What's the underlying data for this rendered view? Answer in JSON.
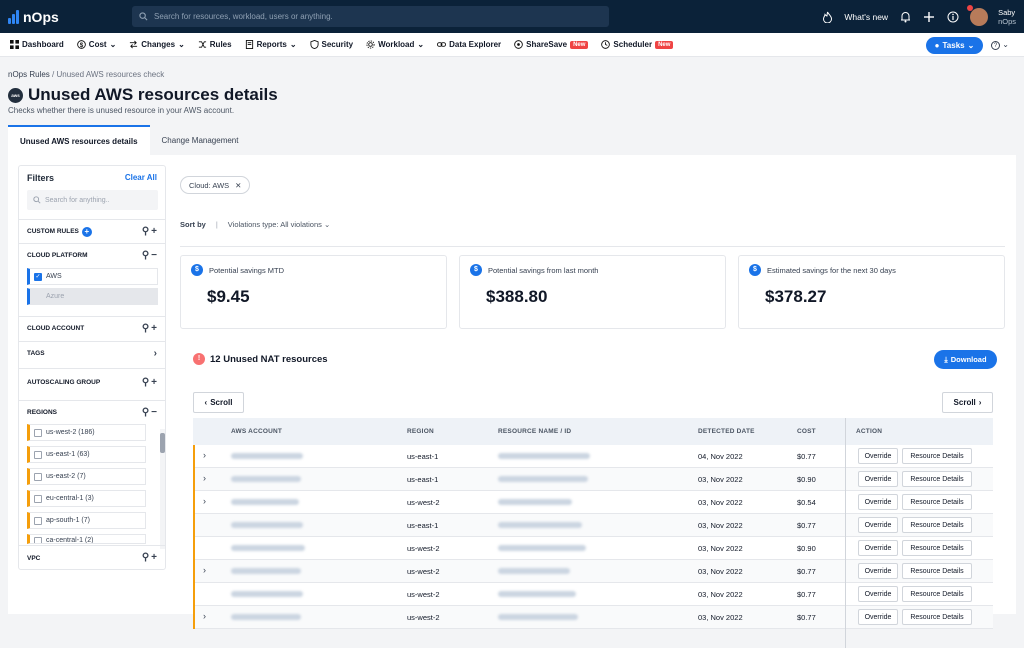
{
  "app": {
    "name": "nOps"
  },
  "search": {
    "placeholder": "Search for resources, workload, users or anything."
  },
  "topbar": {
    "whats_new": "What's new",
    "user_name": "Saby",
    "user_org": "nOps"
  },
  "nav": {
    "items": [
      {
        "label": "Dashboard",
        "icon": "grid-icon"
      },
      {
        "label": "Cost",
        "icon": "dollar-icon",
        "dropdown": true
      },
      {
        "label": "Changes",
        "icon": "changes-icon",
        "dropdown": true
      },
      {
        "label": "Rules",
        "icon": "shuffle-icon"
      },
      {
        "label": "Reports",
        "icon": "report-icon",
        "dropdown": true
      },
      {
        "label": "Security",
        "icon": "shield-icon"
      },
      {
        "label": "Workload",
        "icon": "gear-icon",
        "dropdown": true
      },
      {
        "label": "Data Explorer",
        "icon": "link-icon"
      },
      {
        "label": "ShareSave",
        "icon": "sharesave-icon",
        "badge": "New"
      },
      {
        "label": "Scheduler",
        "icon": "clock-icon",
        "badge": "New"
      }
    ],
    "tasks_label": "Tasks",
    "help_label": "?"
  },
  "breadcrumb": {
    "root": "nOps Rules",
    "current": "Unused AWS resources check"
  },
  "page": {
    "aws_logo_text": "aws",
    "title": "Unused AWS resources details",
    "subtitle": "Checks whether there is unused resource in your AWS account."
  },
  "tabs": [
    {
      "label": "Unused AWS resources details",
      "active": true
    },
    {
      "label": "Change Management",
      "active": false
    }
  ],
  "filters": {
    "title": "Filters",
    "clear_all": "Clear All",
    "search_placeholder": "Search for anything..",
    "sections": {
      "custom_rules": "CUSTOM RULES",
      "cloud_platform": "CLOUD PLATFORM",
      "cloud_account": "CLOUD ACCOUNT",
      "tags": "TAGS",
      "autoscaling": "AUTOSCALING GROUP",
      "regions": "REGIONS",
      "vpc": "VPC"
    },
    "platforms": [
      {
        "label": "AWS",
        "checked": true
      },
      {
        "label": "Azure",
        "checked": false
      }
    ],
    "regions": [
      "us-west-2 (186)",
      "us-east-1 (63)",
      "us-east-2 (7)",
      "eu-central-1 (3)",
      "ap-south-1 (7)",
      "ca-central-1 (2)"
    ]
  },
  "content": {
    "chip": "Cloud: AWS",
    "sort_by": "Sort by",
    "sort_sep": "|",
    "sort_value": "Violations type: All violations",
    "cards": [
      {
        "label": "Potential savings MTD",
        "value": "$9.45"
      },
      {
        "label": "Potential savings from last month",
        "value": "$388.80"
      },
      {
        "label": "Estimated savings for the next 30 days",
        "value": "$378.27"
      }
    ],
    "section_title": "12 Unused NAT resources",
    "download": "Download",
    "scroll_left": "Scroll",
    "scroll_right": "Scroll"
  },
  "table": {
    "headers": [
      "AWS ACCOUNT",
      "REGION",
      "RESOURCE NAME / ID",
      "DETECTED DATE",
      "COST",
      "ACTION"
    ],
    "override_label": "Override",
    "details_label": "Resource Details",
    "rows": [
      {
        "expand": true,
        "region": "us-east-1",
        "date": "04, Nov 2022",
        "cost": "$0.77"
      },
      {
        "expand": true,
        "region": "us-east-1",
        "date": "03, Nov 2022",
        "cost": "$0.90"
      },
      {
        "expand": true,
        "region": "us-west-2",
        "date": "03, Nov 2022",
        "cost": "$0.54"
      },
      {
        "expand": false,
        "region": "us-east-1",
        "date": "03, Nov 2022",
        "cost": "$0.77"
      },
      {
        "expand": false,
        "region": "us-west-2",
        "date": "03, Nov 2022",
        "cost": "$0.90"
      },
      {
        "expand": true,
        "region": "us-west-2",
        "date": "03, Nov 2022",
        "cost": "$0.77"
      },
      {
        "expand": false,
        "region": "us-west-2",
        "date": "03, Nov 2022",
        "cost": "$0.77"
      },
      {
        "expand": true,
        "region": "us-west-2",
        "date": "03, Nov 2022",
        "cost": "$0.77"
      }
    ]
  },
  "colors": {
    "accent": "#1a73e8",
    "topbar": "#0b2239",
    "marker": "#f59e0b",
    "badge": "#ef4444"
  }
}
